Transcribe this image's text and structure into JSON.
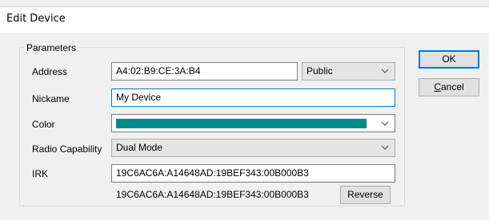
{
  "window": {
    "title": "Edit Device"
  },
  "parameters": {
    "group_label": "Parameters",
    "address": {
      "label": "Address",
      "value": "A4:02:B9:CE:3A:B4",
      "type_selected": "Public"
    },
    "nickname": {
      "label": "Nickame",
      "value": "My Device"
    },
    "color": {
      "label": "Color",
      "swatch": "#008b8b"
    },
    "radio": {
      "label": "Radio Capability",
      "selected": "Dual Mode"
    },
    "irk": {
      "label": "IRK",
      "value": "19C6AC6A:A14648AD:19BEF343:00B000B3",
      "reversed_display": "19C6AC6A:A14648AD:19BEF343:00B000B3",
      "reverse_button": "Reverse"
    }
  },
  "buttons": {
    "ok": "OK",
    "cancel_first": "C",
    "cancel_rest": "ancel"
  },
  "colors": {
    "accent": "#0078d7"
  }
}
